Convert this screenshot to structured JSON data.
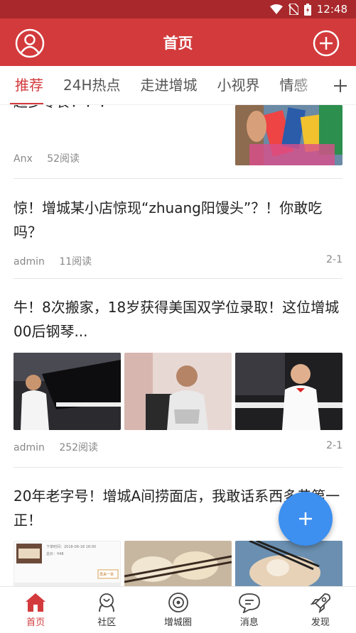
{
  "status_bar": {
    "time": "12:48"
  },
  "header": {
    "title": "首页"
  },
  "tabs": [
    {
      "label": "推荐",
      "active": true
    },
    {
      "label": "24H热点",
      "active": false
    },
    {
      "label": "走进增城",
      "active": false
    },
    {
      "label": "小视界",
      "active": false
    },
    {
      "label": "情感",
      "active": false
    }
  ],
  "articles": [
    {
      "title_partial": "超多零食！！！",
      "author": "Anx",
      "reads": "52阅读",
      "date": ""
    },
    {
      "title": "惊！增城某小店惊现“zhuang阳馒头”？！你敢吃吗？",
      "author": "admin",
      "reads": "11阅读",
      "date": "2-1"
    },
    {
      "title": "牛！8次搬家，18岁获得美国双学位录取！这位增城00后钢琴...",
      "author": "admin",
      "reads": "252阅读",
      "date": "2-1"
    },
    {
      "title": "20年老字号！增城A间捞面店，我敢话系西多巷第一正！",
      "receipt_line1": "下单时间：2018-08-18 18:00",
      "receipt_line2": "总价：¥48",
      "receipt_button": "再来一单"
    }
  ],
  "bottom_nav": [
    {
      "label": "首页",
      "icon": "home-icon",
      "active": true
    },
    {
      "label": "社区",
      "icon": "community-icon",
      "active": false
    },
    {
      "label": "增城圈",
      "icon": "circle-icon",
      "active": false
    },
    {
      "label": "消息",
      "icon": "message-icon",
      "active": false
    },
    {
      "label": "发现",
      "icon": "rocket-icon",
      "active": false
    }
  ],
  "colors": {
    "primary": "#d33a3c",
    "status_bar": "#a8282b",
    "fab": "#3d8ff0",
    "text": "#222222",
    "meta": "#888888"
  }
}
